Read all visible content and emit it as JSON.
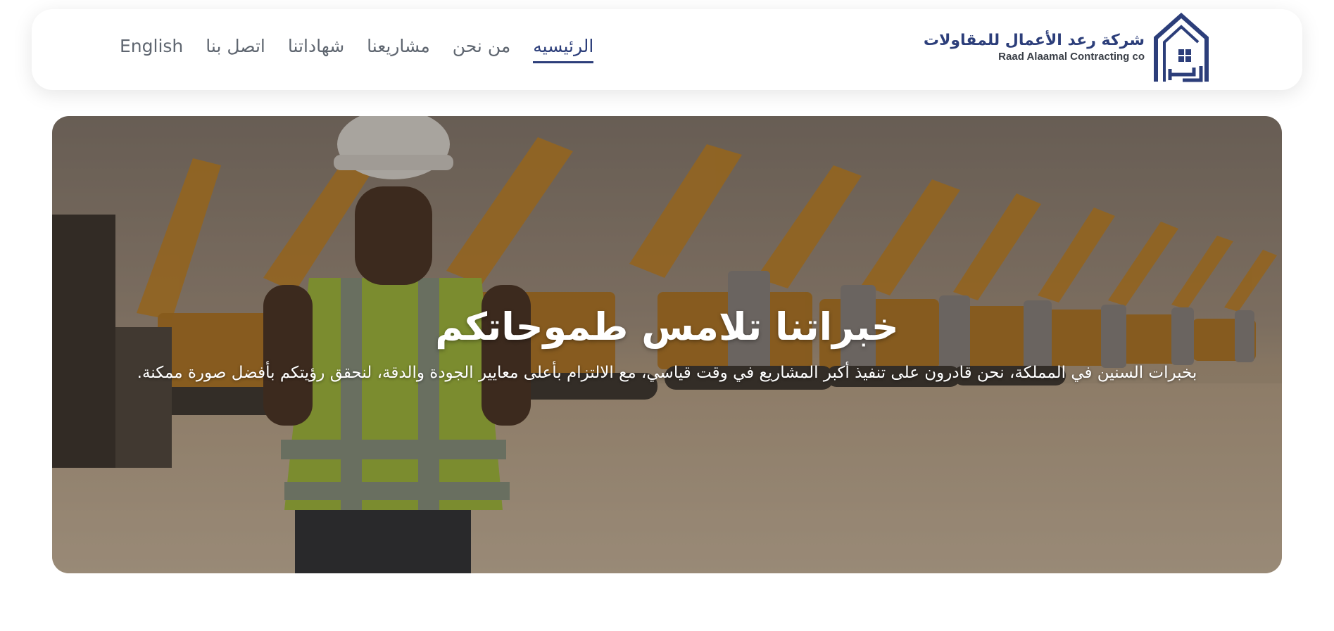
{
  "nav": {
    "links": [
      {
        "label": "English",
        "active": false
      },
      {
        "label": "اتصل بنا",
        "active": false
      },
      {
        "label": "شهاداتنا",
        "active": false
      },
      {
        "label": "مشاريعنا",
        "active": false
      },
      {
        "label": "من نحن",
        "active": false
      },
      {
        "label": "الرئيسيه",
        "active": true
      }
    ]
  },
  "logo": {
    "arabic_name": "شركة رعد الأعمال للمقاولات",
    "english_name": "Raad Alaamal Contracting co",
    "mark_glyph": "رعد",
    "icon": "house-logo-icon",
    "color": "#2c3e7a"
  },
  "hero": {
    "title": "خبراتنا تلامس طموحاتكم",
    "subtitle": ".بخبرات السنين في المملكة، نحن قادرون على تنفيذ أكبر المشاريع في وقت قياسي، مع الالتزام بأعلى معايير الجودة والدقة، لنحقق رؤيتكم بأفضل صورة ممكنة",
    "image": "construction-site-photo"
  },
  "colors": {
    "accent": "#2c3e7a",
    "nav_text": "#5f6670",
    "hero_text": "#ffffff"
  }
}
